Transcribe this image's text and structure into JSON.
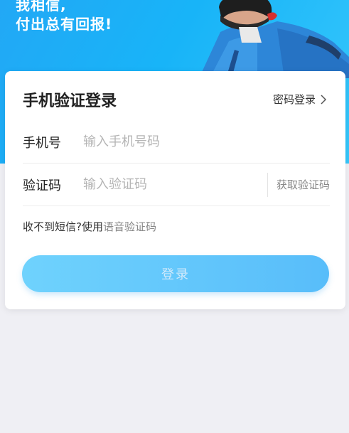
{
  "banner": {
    "line1": "我相信,",
    "line2": "付出总有回报!"
  },
  "login": {
    "title": "手机验证登录",
    "password_login_label": "密码登录",
    "phone_label": "手机号",
    "phone_placeholder": "输入手机号码",
    "code_label": "验证码",
    "code_placeholder": "输入验证码",
    "get_code_label": "获取验证码",
    "hint_prefix": "收不到短信?使用",
    "voice_code_link": "语音验证码",
    "submit_label": "登录"
  },
  "colors": {
    "accent": "#2aaef6",
    "button_start": "#6fd2fd",
    "button_end": "#58bdfa"
  }
}
